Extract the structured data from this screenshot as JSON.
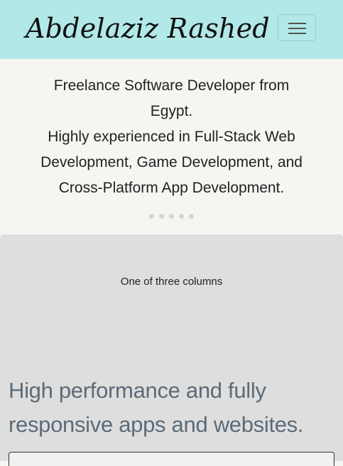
{
  "navbar": {
    "brand": "Abdelaziz Rashed",
    "toggler_icon": "hamburger-icon"
  },
  "hero": {
    "lines": [
      "Freelance Software Developer from",
      "Egypt.",
      "Highly experienced in Full-Stack Web",
      "Development, Game Development, and",
      "Cross-Platform App Development."
    ],
    "indicator_count": 5
  },
  "section": {
    "column_label": "One of three columns",
    "headline_lines": [
      "High performance and fully",
      "responsive apps and websites."
    ]
  },
  "colors": {
    "navbar_bg": "#b3e8e8",
    "hero_bg": "#f6f5f2",
    "section_bg": "#dedede",
    "headline": "#5c6b78"
  }
}
